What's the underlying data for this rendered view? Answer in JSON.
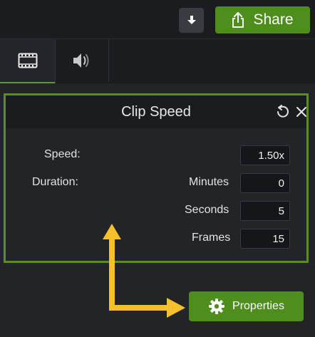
{
  "topbar": {
    "share_label": "Share",
    "download_icon": "download-arrow-icon",
    "share_icon": "share-export-icon"
  },
  "tabs": [
    {
      "name": "visual-properties",
      "icon": "film-strip-icon",
      "selected": true
    },
    {
      "name": "audio-properties",
      "icon": "speaker-icon",
      "selected": false
    }
  ],
  "clip_speed": {
    "title": "Clip Speed",
    "speed_label": "Speed:",
    "speed_value": "1.50x",
    "duration_label": "Duration:",
    "minutes_label": "Minutes",
    "minutes_value": "0",
    "seconds_label": "Seconds",
    "seconds_value": "5",
    "frames_label": "Frames",
    "frames_value": "15"
  },
  "footer": {
    "properties_label": "Properties"
  },
  "colors": {
    "accent_green": "#4d8e1d",
    "highlight_green": "#5a8f20",
    "annotation_arrow": "#f5c02a",
    "background": "#1a1b1e",
    "panel": "#232428"
  }
}
